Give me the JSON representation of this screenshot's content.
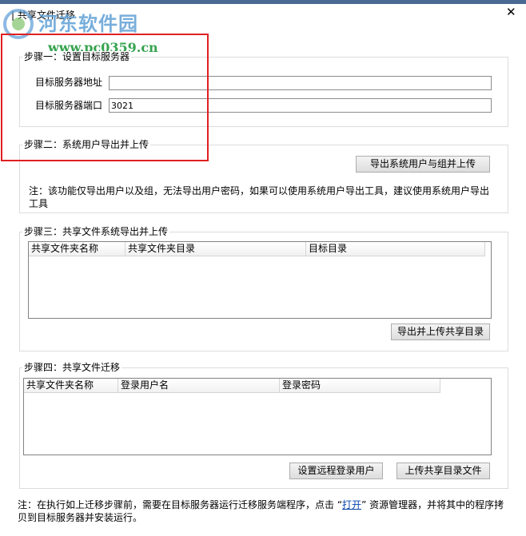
{
  "window": {
    "title": "共享文件迁移",
    "close_glyph": "✕"
  },
  "watermark": {
    "site_name": "河东软件园",
    "url": "www.pc0359.cn"
  },
  "step1": {
    "label": "步骤一：设置目标服务器",
    "address_label": "目标服务器地址",
    "address_value": "",
    "port_label": "目标服务器端口",
    "port_value": "3021"
  },
  "step2": {
    "label": "步骤二：系统用户导出并上传",
    "export_button": "导出系统用户与组并上传",
    "note": "注：该功能仅导出用户以及组，无法导出用户密码，如果可以使用系统用户导出工具，建议使用系统用户导出工具"
  },
  "step3": {
    "label": "步骤三：共享文件系统导出并上传",
    "columns": [
      "共享文件夹名称",
      "共享文件夹目录",
      "目标目录"
    ],
    "rows": [],
    "export_button": "导出并上传共享目录"
  },
  "step4": {
    "label": "步骤四：共享文件迁移",
    "columns": [
      "共享文件夹名称",
      "登录用户名",
      "登录密码"
    ],
    "rows": [],
    "set_login_button": "设置远程登录用户",
    "upload_button": "上传共享目录文件"
  },
  "footer": {
    "note_before": "注：在执行如上迁移步骤前，需要在目标服务器运行迁移服务端程序，点击 “",
    "link": "打开",
    "note_after": "” 资源管理器，并将其中的程序拷贝到目标服务器并安装运行。"
  },
  "colors": {
    "accent": "#4a6a93",
    "highlight_box": "#e02020",
    "link": "#0645ad"
  }
}
